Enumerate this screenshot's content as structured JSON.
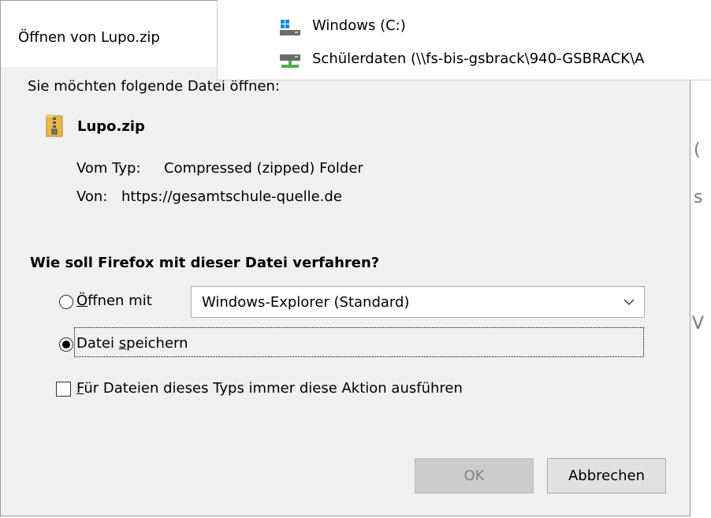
{
  "dialog": {
    "title": "Öffnen von Lupo.zip",
    "intro": "Sie möchten folgende Datei öffnen:",
    "file": {
      "name": "Lupo.zip",
      "type_label": "Vom Typ:",
      "type_value": "Compressed (zipped) Folder",
      "from_label": "Von:",
      "from_value": "https://gesamtschule-quelle.de"
    },
    "question": "Wie soll Firefox mit dieser Datei verfahren?",
    "open_with": {
      "label_prefix": "Ö",
      "label_rest": "ffnen mit",
      "selected_app": "Windows-Explorer (Standard)",
      "checked": false
    },
    "save_file": {
      "label_prefix": "Datei ",
      "label_ul": "s",
      "label_rest": "peichern",
      "checked": true
    },
    "always_action": {
      "label_ul": "F",
      "label_rest": "ür Dateien dieses Typs immer diese Aktion ausführen",
      "checked": false
    },
    "buttons": {
      "ok": "OK",
      "cancel": "Abbrechen"
    }
  },
  "drives_overlay": {
    "items": [
      {
        "label": "Windows (C:)",
        "icon": "windows-drive-icon"
      },
      {
        "label": "Schülerdaten (\\\\fs-bis-gsbrack\\940-GSBRACK\\A",
        "icon": "network-drive-icon"
      }
    ]
  },
  "colors": {
    "dialog_bg": "#f0f0f0",
    "zip_icon": "#e8b84a",
    "ok_disabled_text": "#838383"
  }
}
